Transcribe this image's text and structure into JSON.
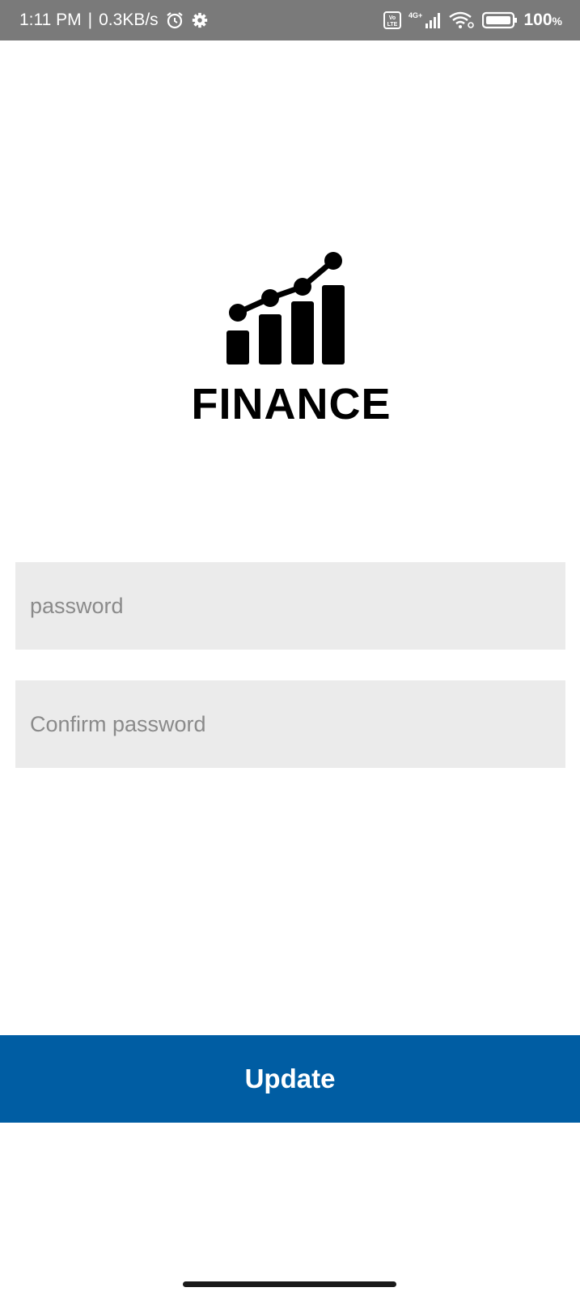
{
  "status_bar": {
    "time": "1:11 PM",
    "separator": "|",
    "speed": "0.3KB/s",
    "battery_percent": "100",
    "battery_suffix": "%",
    "icons": [
      "alarm-icon",
      "gear-icon",
      "volte-icon",
      "signal-4g-icon",
      "wifi-icon",
      "battery-icon"
    ]
  },
  "logo": {
    "icon": "bar-chart-growth-icon",
    "text": "FINANCE"
  },
  "form": {
    "password_placeholder": "password",
    "password_value": "",
    "confirm_placeholder": "Confirm password",
    "confirm_value": ""
  },
  "actions": {
    "update_label": "Update"
  },
  "colors": {
    "status_bar": "#7a7a7a",
    "field_bg": "#ebebeb",
    "primary": "#005da3"
  }
}
